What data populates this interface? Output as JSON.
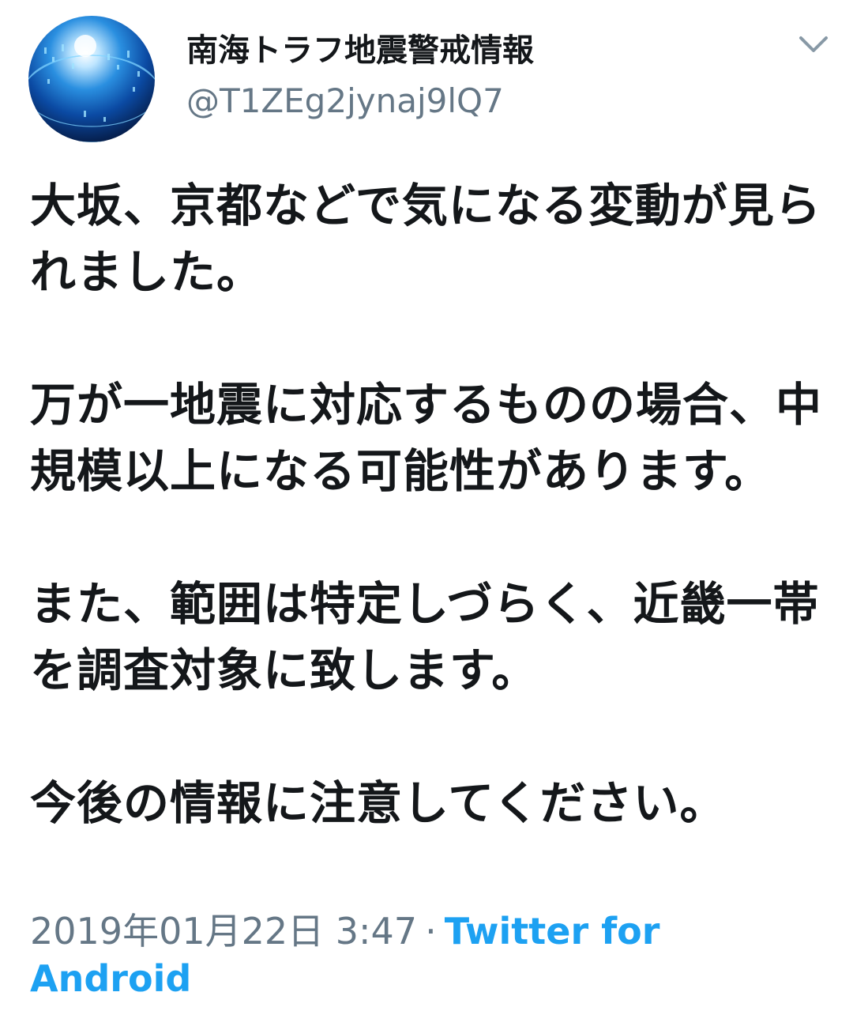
{
  "tweet": {
    "display_name": "南海トラフ地震警戒情報",
    "handle": "@T1ZEg2jynaj9lQ7",
    "avatar_icon": "globe-digital-avatar",
    "menu_icon": "chevron-down-icon",
    "paragraphs": [
      "大坂、京都などで気になる変動が見られました。",
      "万が一地震に対応するものの場合、中規模以上になる可能性があります。",
      "また、範囲は特定しづらく、近畿一帯を調査対象に致します。",
      "今後の情報に注意してください。"
    ],
    "timestamp": "2019年01月22日 3:47",
    "separator": "·",
    "source": "Twitter for Android"
  },
  "colors": {
    "text": "#14171a",
    "secondary": "#657786",
    "link": "#1da1f2"
  }
}
